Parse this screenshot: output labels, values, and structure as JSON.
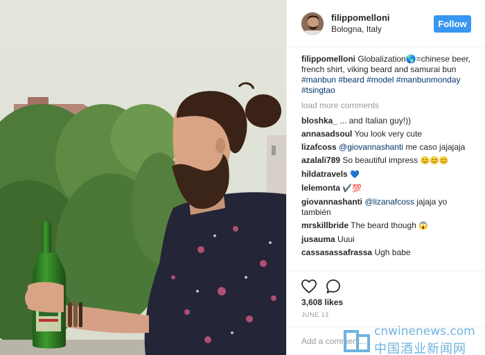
{
  "post": {
    "username": "filippomelloni",
    "location": "Bologna, Italy",
    "follow_label": "Follow",
    "caption_text": "Globalization🌎=chinese beer, french shirt, viking beard and samurai bun",
    "hashtags": "#manbun #beard #model #manbunmonday #tsingtao",
    "load_more": "load more comments",
    "likes": "3,608 likes",
    "date": "JUNE 13",
    "add_comment_placeholder": "Add a comment..."
  },
  "comments": [
    {
      "user": "bloshka_",
      "text": "... and Italian guy!))"
    },
    {
      "user": "annasadsoul",
      "text": "You look very cute"
    },
    {
      "user": "lizafcoss",
      "mention": "@giovannashanti",
      "text": "me caso jajajaja"
    },
    {
      "user": "azalali789",
      "text": "So beautiful impress",
      "emoji": "😊😊😊"
    },
    {
      "user": "hildatravels",
      "text": "",
      "emoji": "💙"
    },
    {
      "user": "lelemonta",
      "text": "",
      "emoji": "✔️💯"
    },
    {
      "user": "giovannashanti",
      "mention": "@lizanafcoss",
      "text": "jajaja yo también"
    },
    {
      "user": "mrskillbride",
      "text": "The beard though",
      "emoji": "😱"
    },
    {
      "user": "jusauma",
      "text": "Uuui"
    },
    {
      "user": "cassasassafrassa",
      "text": "Ugh babe"
    }
  ],
  "icons": {
    "like": "heart-icon",
    "comment": "comment-bubble-icon"
  },
  "watermark": {
    "url": "cnwinenews.com",
    "cn": "中国酒业新闻网"
  },
  "colors": {
    "accent": "#3897f0",
    "link": "#003569",
    "muted": "#999999"
  }
}
